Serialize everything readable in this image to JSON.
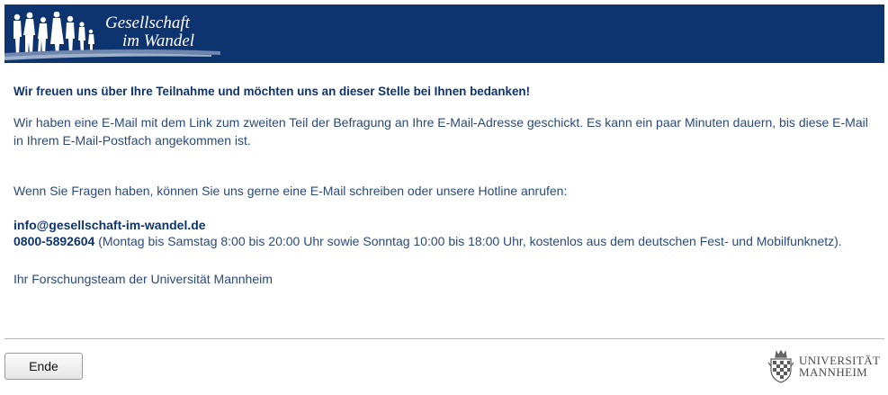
{
  "header": {
    "brand_line1": "Gesellschaft",
    "brand_line2": "im Wandel"
  },
  "content": {
    "thanks": "Wir freuen uns über Ihre Teilnahme und möchten uns an dieser Stelle bei Ihnen bedanken!",
    "info": "Wir haben eine E-Mail mit dem Link zum zweiten Teil der Befragung an Ihre E-Mail-Adresse geschickt. Es kann ein paar Minuten dauern, bis diese E-Mail in Ihrem E-Mail-Postfach angekommen ist.",
    "questions": "Wenn Sie Fragen haben, können Sie uns gerne eine E-Mail schreiben oder unsere Hotline anrufen:",
    "email": "info@gesellschaft-im-wandel.de",
    "phone": "0800-5892604",
    "phone_note": " (Montag bis Samstag 8:00 bis 20:00 Uhr sowie Sonntag 10:00 bis 18:00 Uhr, kostenlos aus dem deutschen Fest- und Mobilfunknetz).",
    "signature": "Ihr Forschungsteam der Universität Mannheim"
  },
  "footer": {
    "end_label": "Ende",
    "uni_line1": "UNIVERSITÄT",
    "uni_line2": "MANNHEIM"
  },
  "colors": {
    "header_bg": "#0e3470",
    "text": "#1f3864",
    "divider": "#b7b7b7"
  },
  "icons": {
    "header_graphic": "people-silhouettes-icon",
    "university_crest": "university-crest-icon"
  }
}
